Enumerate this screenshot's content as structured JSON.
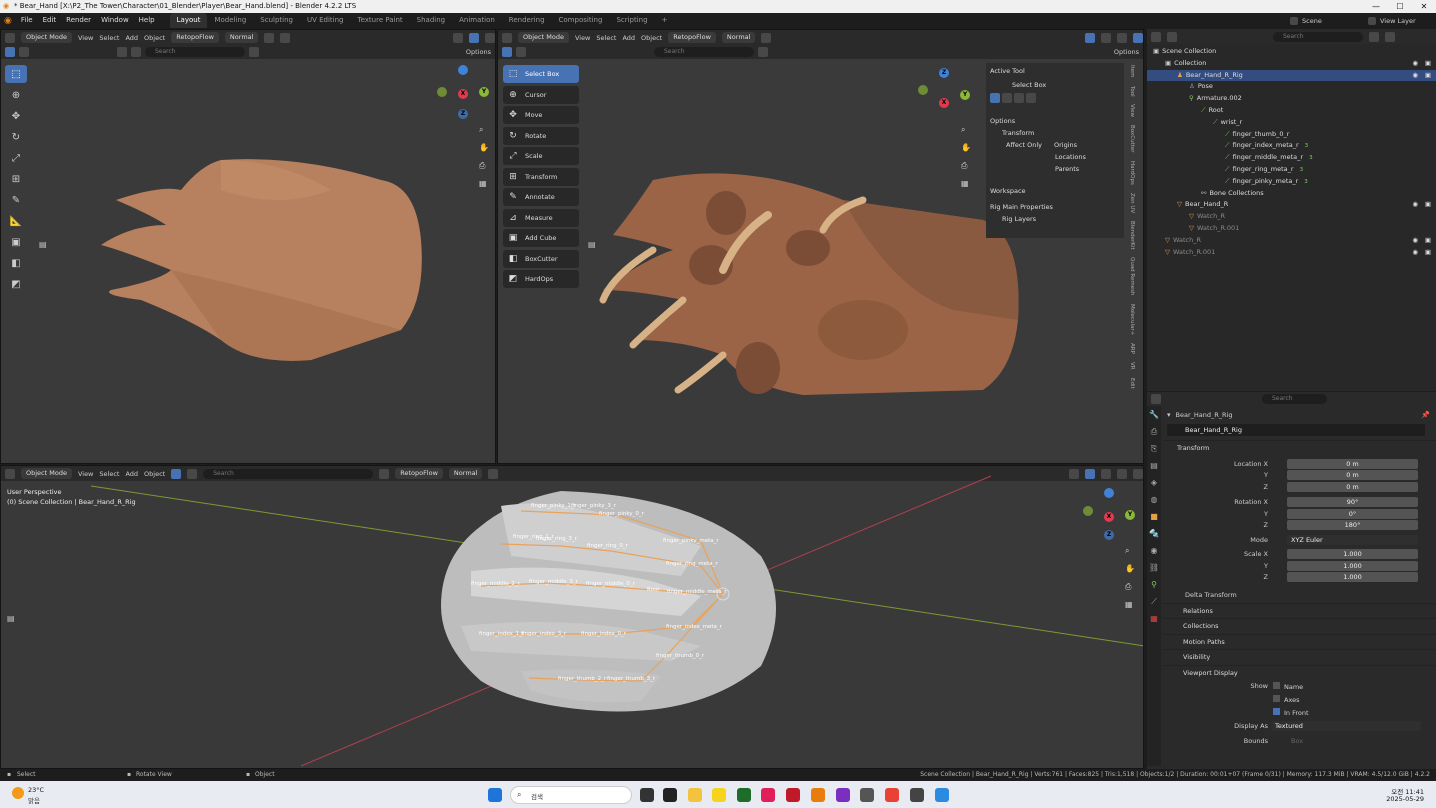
{
  "window": {
    "title": "* Bear_Hand [X:\\P2_The Tower\\Character\\01_Blender\\Player\\Bear_Hand.blend] - Blender 4.2.2 LTS",
    "minimize": "—",
    "maximize": "☐",
    "close": "✕"
  },
  "menu": [
    "File",
    "Edit",
    "Render",
    "Window",
    "Help"
  ],
  "workspaces": [
    "Layout",
    "Modeling",
    "Sculpting",
    "UV Editing",
    "Texture Paint",
    "Shading",
    "Animation",
    "Rendering",
    "Compositing",
    "Scripting",
    "+"
  ],
  "active_workspace": "Layout",
  "topbar_right": {
    "scene": "Scene",
    "view_layer": "View Layer",
    "search_placeholder": "Search"
  },
  "viewport_header": {
    "mode": "Object Mode",
    "view": "View",
    "select": "Select",
    "add": "Add",
    "object": "Object",
    "retopoflow": "RetopoFlow",
    "orientation": "Normal",
    "options": "Options",
    "search_placeholder": "Search"
  },
  "toolbar_tools": [
    "select-box",
    "cursor",
    "move",
    "rotate",
    "scale",
    "transform",
    "annotate",
    "measure",
    "add-cube",
    "boxcutter",
    "hardops"
  ],
  "tool_panel": [
    "Select Box",
    "Cursor",
    "Move",
    "Rotate",
    "Scale",
    "Transform",
    "Annotate",
    "Measure",
    "Add Cube",
    "BoxCutter",
    "HardOps"
  ],
  "n_panel": {
    "active_tool": "Active Tool",
    "select_box": "Select Box",
    "options": "Options",
    "transform": "Transform",
    "affect_only": "Affect Only",
    "origins": "Origins",
    "locations": "Locations",
    "parents": "Parents",
    "workspace": "Workspace",
    "rig_main": "Rig Main Properties",
    "rig_layers": "Rig Layers"
  },
  "side_tabs": [
    "Item",
    "Tool",
    "View",
    "BoxCutter",
    "HardOps",
    "Zen UV",
    "BlenderKit",
    "Quad Remesh",
    "Molecular+",
    "ARP",
    "VR",
    "Edit"
  ],
  "bottom_viewport": {
    "perspective": "User Perspective",
    "collection": "(0) Scene Collection | Bear_Hand_R_Rig",
    "bone_labels": [
      "finger_pinky_1_r",
      "finger_pinky_3_r",
      "finger_pinky_0_r",
      "finger_ring_1_r",
      "finger_ring_3_r",
      "finger_ring_0_r",
      "finger_pinky_meta_r",
      "finger_ring_meta_r",
      "finger_middle_2_r",
      "finger_middle_3_r",
      "finger_middle_0_r",
      "Root",
      "finger_middle_meta_r",
      "finger_index_1_r",
      "finger_index_3_r",
      "finger_index_0_r",
      "finger_index_meta_r",
      "finger_thumb_0_r",
      "finger_thumb_2_r",
      "finger_thumb_3_r"
    ]
  },
  "outliner": {
    "search_placeholder": "Search",
    "rows": [
      {
        "label": "Scene Collection",
        "indent": 0,
        "icon": "collection-icon"
      },
      {
        "label": "Collection",
        "indent": 1,
        "icon": "collection-icon"
      },
      {
        "label": "Bear_Hand_R_Rig",
        "indent": 2,
        "icon": "armature-icon",
        "selected": true
      },
      {
        "label": "Pose",
        "indent": 3,
        "icon": "pose-icon"
      },
      {
        "label": "Armature.002",
        "indent": 3,
        "icon": "armature-data-icon"
      },
      {
        "label": "Root",
        "indent": 4,
        "icon": "bone-icon"
      },
      {
        "label": "wrist_r",
        "indent": 5,
        "icon": "bone-icon"
      },
      {
        "label": "finger_thumb_0_r",
        "indent": 6,
        "icon": "bone-icon"
      },
      {
        "label": "finger_index_meta_r",
        "indent": 6,
        "icon": "bone-icon"
      },
      {
        "label": "finger_middle_meta_r",
        "indent": 6,
        "icon": "bone-icon"
      },
      {
        "label": "finger_ring_meta_r",
        "indent": 6,
        "icon": "bone-icon"
      },
      {
        "label": "finger_pinky_meta_r",
        "indent": 6,
        "icon": "bone-icon"
      },
      {
        "label": "Bone Collections",
        "indent": 4,
        "icon": "bone-collection-icon"
      },
      {
        "label": "Bear_Hand_R",
        "indent": 2,
        "icon": "mesh-icon"
      },
      {
        "label": "Watch_R",
        "indent": 3,
        "icon": "mesh-icon",
        "dim": true
      },
      {
        "label": "Watch_R.001",
        "indent": 3,
        "icon": "mesh-icon",
        "dim": true
      },
      {
        "label": "Watch_R",
        "indent": 1,
        "icon": "mesh-icon",
        "dim": true
      },
      {
        "label": "Watch_R.001",
        "indent": 1,
        "icon": "mesh-icon",
        "dim": true
      }
    ],
    "bone_counts": [
      "3",
      "3",
      "3",
      "3"
    ]
  },
  "properties": {
    "search_placeholder": "Search",
    "object_name": "Bear_Hand_R_Rig",
    "object_field": "Bear_Hand_R_Rig",
    "transform": "Transform",
    "location_label": "Location X",
    "location": [
      "0 m",
      "0 m",
      "0 m"
    ],
    "rotation_label": "Rotation X",
    "rotation": [
      "90°",
      "0°",
      "180°"
    ],
    "mode_label": "Mode",
    "mode": "XYZ Euler",
    "scale_label": "Scale X",
    "scale": [
      "1.000",
      "1.000",
      "1.000"
    ],
    "axis_y": "Y",
    "axis_z": "Z",
    "delta_transform": "Delta Transform",
    "sections": [
      "Relations",
      "Collections",
      "Motion Paths",
      "Visibility",
      "Viewport Display"
    ],
    "viewport_display": {
      "show": "Show",
      "name": "Name",
      "axes": "Axes",
      "in_front": "In Front",
      "display_as_label": "Display As",
      "display_as": "Textured",
      "bounds": "Bounds",
      "bounds_value": "Box"
    }
  },
  "statusbar": {
    "select": "Select",
    "rotate_view": "Rotate View",
    "object": "Object",
    "stats": "Scene Collection | Bear_Hand_R_Rig | Verts:761 | Faces:825 | Tris:1,518 | Objects:1/2 | Duration: 00:01+07 (Frame 0/31) | Memory: 117.3 MiB | VRAM: 4.5/12.0 GiB | 4.2.2"
  },
  "taskbar": {
    "temp": "23°C",
    "weather": "맑음",
    "search": "검색",
    "time": "오전 11:41",
    "date": "2025-05-29"
  },
  "colors": {
    "accent": "#4772b3",
    "skin": "#b87a55",
    "bone": "#e9a25a",
    "x_axis": "#e23a4f",
    "y_axis": "#8ab838",
    "z_axis": "#3f83d8"
  }
}
